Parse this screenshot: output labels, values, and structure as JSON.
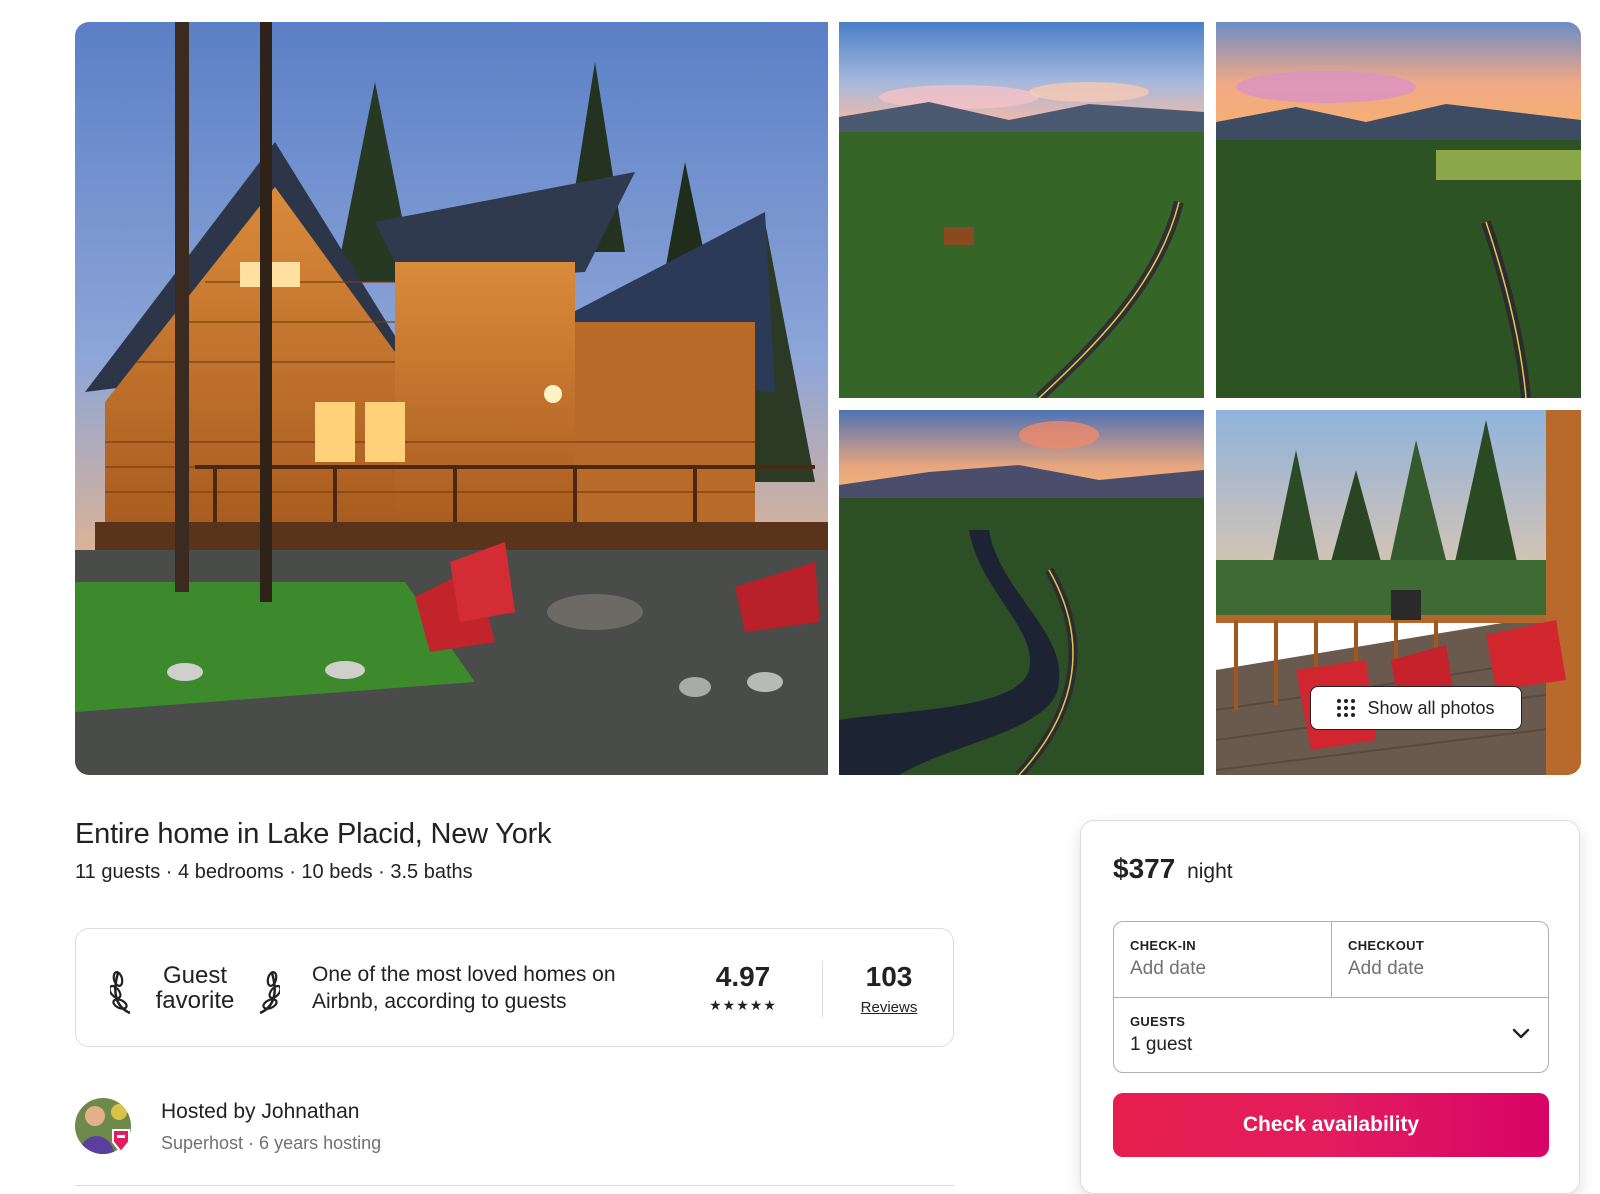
{
  "gallery": {
    "show_all_label": "Show all photos"
  },
  "listing": {
    "title": "Entire home in Lake Placid, New York",
    "subtitle": "11 guests · 4 bedrooms · 10 beds · 3.5 baths"
  },
  "guest_favorite": {
    "badge_line1": "Guest",
    "badge_line2": "favorite",
    "description_line1": "One of the most loved homes on",
    "description_line2": "Airbnb, according to guests",
    "rating": "4.97",
    "stars": "★★★★★",
    "reviews_count": "103",
    "reviews_label": "Reviews"
  },
  "host": {
    "name": "Hosted by Johnathan",
    "meta": "Superhost · 6 years hosting"
  },
  "booking": {
    "price": "$377",
    "price_unit": "night",
    "checkin_label": "CHECK-IN",
    "checkin_value": "Add date",
    "checkout_label": "CHECKOUT",
    "checkout_value": "Add date",
    "guests_label": "GUESTS",
    "guests_value": "1 guest",
    "cta_label": "Check availability"
  },
  "colors": {
    "brand": "#e31c5f",
    "text": "#222222",
    "muted": "#717171",
    "border": "#dddddd"
  },
  "icons": [
    "grid-dots-icon",
    "laurel-left-icon",
    "laurel-right-icon",
    "chevron-down-icon",
    "superhost-badge-icon"
  ]
}
